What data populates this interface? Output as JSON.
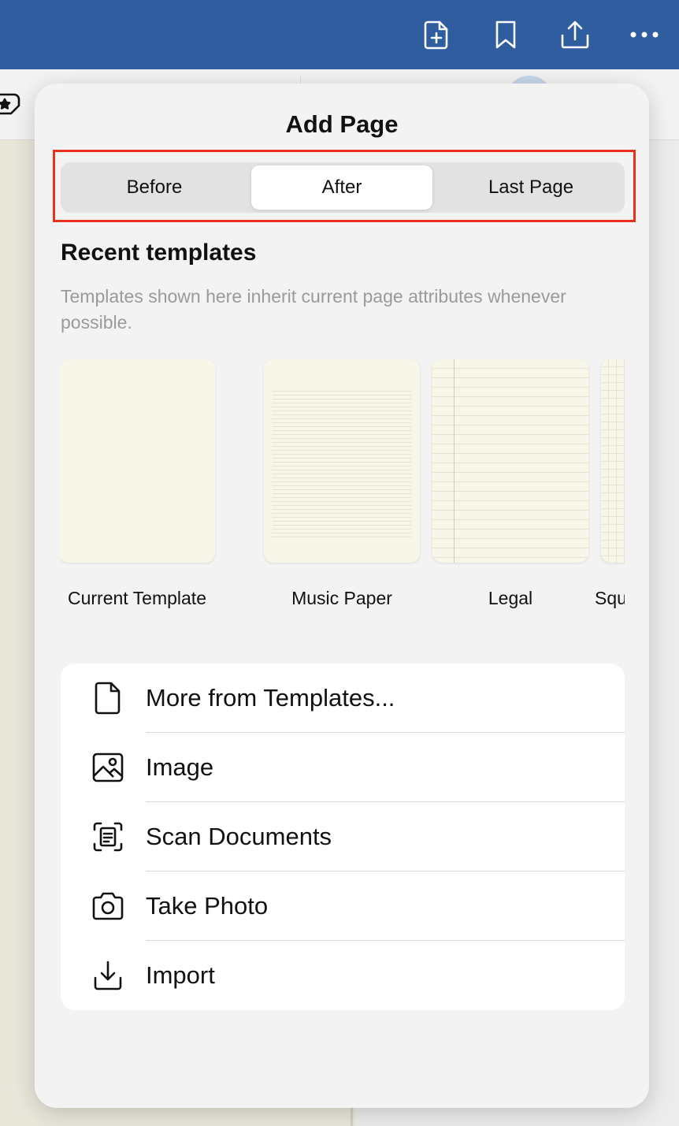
{
  "topbar": {
    "icons": [
      "add-page-icon",
      "bookmark-icon",
      "share-icon",
      "more-icon"
    ],
    "color": "#2f5da0"
  },
  "popover": {
    "title": "Add Page",
    "position_options": [
      {
        "label": "Before",
        "selected": false
      },
      {
        "label": "After",
        "selected": true
      },
      {
        "label": "Last Page",
        "selected": false
      }
    ],
    "highlight_color": "#e8331c",
    "recent_templates": {
      "title": "Recent templates",
      "description": "Templates shown here inherit current page attributes whenever possible.",
      "items": [
        {
          "label": "Current Template",
          "style": "blank"
        },
        {
          "label": "Music Paper",
          "style": "music"
        },
        {
          "label": "Legal",
          "style": "legal"
        },
        {
          "label": "Square",
          "style": "grid"
        }
      ]
    },
    "actions": [
      {
        "label": "More from Templates...",
        "icon": "document-icon"
      },
      {
        "label": "Image",
        "icon": "image-icon"
      },
      {
        "label": "Scan Documents",
        "icon": "scan-icon"
      },
      {
        "label": "Take Photo",
        "icon": "camera-icon"
      },
      {
        "label": "Import",
        "icon": "import-icon"
      }
    ]
  }
}
